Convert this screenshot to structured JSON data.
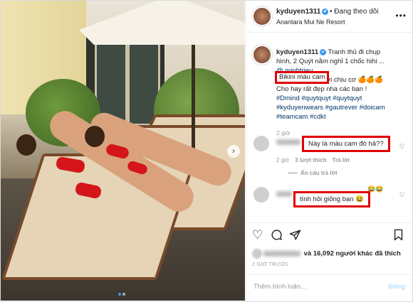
{
  "header": {
    "username": "kyduyen1311",
    "verified_mark": "✔",
    "follow_status": "• Đang theo dõi",
    "location": "Anantara Mui Ne Resort",
    "more_icon": "more-horizontal-icon"
  },
  "caption": {
    "username": "kyduyen1311",
    "line1": "Tranh thủ đi chụp",
    "line2": "hình, 2 Quýt nằm nghỉ 1 chốc hihi ...",
    "mention": "@ minhtrieu",
    "highlight": "Bikini màu cam",
    "line3_rest": " mới chịu cơ 🍊🍊🍊",
    "line4": "Cho hay rất đẹp nha các bạn !",
    "hashtags_1": "#Dmind #quytquyt #quytquyt",
    "hashtags_2": "#kyduyenwears #gautrever #doicam",
    "hashtags_3": "#teamcam #cdkt",
    "time": "2 giờ"
  },
  "comments": [
    {
      "text": "Này là màu cam đó hả??",
      "time": "2 giờ",
      "likes": "3 lượt thích",
      "reply": "Trả lời",
      "hide_replies": "Ẩn câu trả lời"
    },
    {
      "text": "tính hỏi giống bạn 😆",
      "emoji_after": "😂😂"
    }
  ],
  "actions": {
    "like_icon": "heart-icon",
    "comment_icon": "comment-icon",
    "share_icon": "share-icon",
    "save_icon": "bookmark-icon"
  },
  "likes": {
    "text": "và 16,092 người khác đã thích"
  },
  "post_time": "2 GIỜ TRƯỚC",
  "add_comment": {
    "placeholder": "Thêm bình luận...",
    "post_label": "Đăng"
  },
  "colors": {
    "highlight_border": "#e00000",
    "link": "#003569",
    "verified": "#3897f0",
    "post_disabled": "#b2dffc"
  }
}
